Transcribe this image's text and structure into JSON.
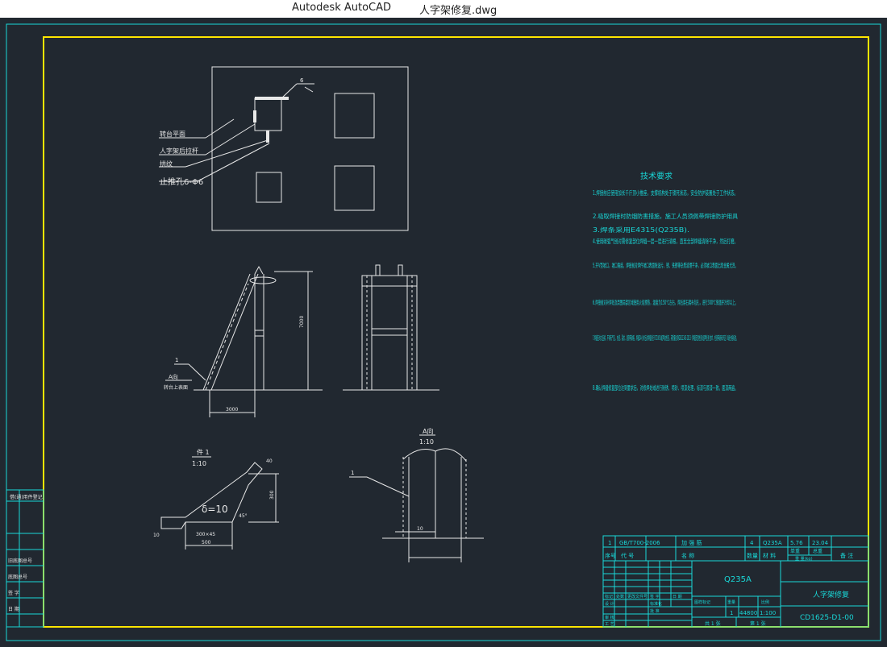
{
  "window": {
    "app_name": "Autodesk AutoCAD",
    "file_name": "人字架修复.dwg"
  },
  "plan_view": {
    "labels": [
      "转台平面",
      "人字架后拉杆",
      "拱纹",
      "止推孔6-Φ6"
    ],
    "weld_symbol": "6"
  },
  "elevation": {
    "height_dim": "7000",
    "width_dim": "3000",
    "part_no": "1",
    "section_ref": "A向",
    "note": "转台上表面"
  },
  "detail_1": {
    "title": "件 1",
    "scale": "1:10",
    "thickness": "δ=10",
    "dim_500": "500",
    "dim_300": "300",
    "dim_300x45": "300×45",
    "dim_45": "45°",
    "dim_40": "40",
    "dim_10": "10"
  },
  "detail_A": {
    "title": "A向",
    "scale": "1:10",
    "part_no": "1",
    "dim_10": "10",
    "dim_350": "350"
  },
  "tech": {
    "title": "技术要求",
    "items": [
      "1.焊接前应使用加长千斤顶小推座，支撑机构处于锁死状态，安全防护装置处于工作状态。",
      "2.吸取焊接时防烟防害措施，施工人员须佩带焊接防护用具",
      "3.焊条采用E4315(Q235B).",
      "4.使用碳弧气刨对需修复部位焊缝一层一层进行清根，直至全部焊缝清除干净，然后打磨。",
      "5.开V型坡口，坡口角度，焊接前对焊件坡口表面除油污、锈、铁锈等杂质清理干净，必须坡口表面出现金属光泽。",
      "6.焊接前对补焊处及周围局部区域使用火焰预热，温度为150℃左右，焊后用石棉布包扎，进行300℃保温并冷却以上。",
      "7.焊缝应均匀连续，不得有气孔、夹渣、裂纹、烧穿等缺陷，焊缝24小时后对焊缝进行UT100%超声波检查，其质量达到GB11345-2013《焊缝无损检测 超声检测 技术、检测等级和评定》Ⅱ级合格标准。",
      "8.确认焊缝修复部位达到要求后，对修焊处域进行除锈、喷砂、喷漆处理，标漆与原漆一致，面漆两遍。"
    ]
  },
  "title_block": {
    "row1": [
      "1",
      "GB/T700-2006",
      "加 强 筋",
      "4",
      "Q235A",
      "5.76",
      "23.04"
    ],
    "row2": [
      "序号",
      "代 号",
      "名 称",
      "数量",
      "材 料",
      "单重",
      "总重",
      "备 注"
    ],
    "weight_unit": "重 量(kg)",
    "material": "Q235A",
    "name": "人字架修复",
    "code": "CD1625-D1-00",
    "scale_row": [
      "图样标记",
      "重量",
      "比例"
    ],
    "scale_values": [
      "1",
      "44800",
      "1:100"
    ],
    "sheets": [
      "共 1 张",
      "第 1 张"
    ],
    "sign_labels": [
      "标记",
      "处数",
      "更改文件号",
      "签 字",
      "日 期",
      "设 计",
      "审 核",
      "工 艺",
      "标准化",
      "批 准"
    ]
  },
  "left_strip": [
    "借(通)用件登记",
    "旧底图总号",
    "底图总号",
    "签 字",
    "日 期"
  ]
}
